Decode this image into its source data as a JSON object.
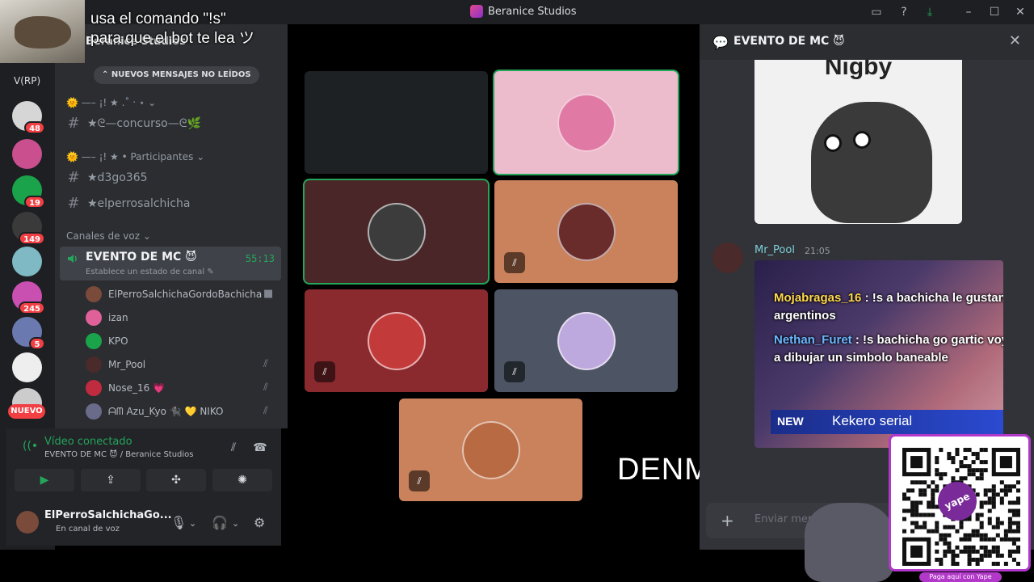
{
  "window": {
    "title": "Beranice Studios"
  },
  "overlay": {
    "command_line1": "usa el comando \"!s\"",
    "command_line2": "para que el bot te lea",
    "command_suffix": "ツ",
    "money_text": "DENME PLATA :,V",
    "qr_caption": "Paga aquí con Yape",
    "yape_label": "yape"
  },
  "rail": {
    "label": "V(RP)",
    "servers": [
      {
        "badge": "48",
        "color": "#d6d6d6"
      },
      {
        "badge": "",
        "color": "#c94f8f"
      },
      {
        "badge": "19",
        "color": "#1aa34a"
      },
      {
        "badge": "149",
        "color": "#3a3a3a"
      },
      {
        "badge": "",
        "color": "#7fb9c4"
      },
      {
        "badge": "245",
        "color": "#c94fb0"
      },
      {
        "badge": "5",
        "color": "#6a7ab0"
      },
      {
        "badge": "",
        "color": "#eeeeee"
      },
      {
        "badge": "",
        "color": "#cccccc"
      }
    ],
    "nuevo_label": "NUEVO"
  },
  "sidebar": {
    "server_name": "Beranice Studios",
    "new_messages_label": "NUEVOS MENSAJES NO LEÍDOS",
    "categories": [
      {
        "label": "—– ¡! ★ .˚ ‧ ⋆",
        "icon": "sun-emoji"
      },
      {
        "label": "—– ¡! ★ • Participantes",
        "icon": "sun-emoji"
      }
    ],
    "channels": [
      {
        "name": "★ᘓ—concurso—ᘓ🌿"
      },
      {
        "name": "★d3go365"
      },
      {
        "name": "★elperrosalchicha"
      }
    ],
    "voice_category": "Canales de voz",
    "voice_channel": {
      "name": "EVENTO DE MC 😈",
      "timer": "55:13",
      "status_placeholder": "Establece un estado de canal"
    },
    "members": [
      {
        "name": "ElPerroSalchichaGordoBachicha",
        "icon": "camera-icon",
        "color": "#7a4a3a"
      },
      {
        "name": "izan",
        "icon": "",
        "color": "#e0609a"
      },
      {
        "name": "KPO",
        "icon": "",
        "color": "#1aa34a"
      },
      {
        "name": "Mr_Pool",
        "icon": "muted-mic-icon",
        "color": "#4a2a2a"
      },
      {
        "name": "Nose_16 💗",
        "icon": "muted-mic-icon",
        "color": "#c02b3f"
      },
      {
        "name": "ᗩᗰ Azu_Kyo 🐈‍⬛ 💛 NIKO",
        "icon": "muted-mic-icon",
        "color": "#6a6a8a"
      }
    ]
  },
  "voice_panel": {
    "title": "Vídeo conectado",
    "subtitle": "EVENTO DE MC 😈 / Beranice Studios",
    "buttons": [
      "camera",
      "screen-share",
      "activities",
      "soundboard"
    ]
  },
  "user_panel": {
    "name": "ElPerroSalchichaGo...",
    "status": "En canal de voz"
  },
  "video_tiles": [
    {
      "bg": "#1e2124",
      "avatar": "",
      "speaking": false,
      "muted": false
    },
    {
      "bg": "#ecbccc",
      "avatar": "#e07aa4",
      "speaking": true,
      "muted": false
    },
    {
      "bg": "#4a2628",
      "avatar": "#3c3c3c",
      "speaking": true,
      "muted": false
    },
    {
      "bg": "#c9825b",
      "avatar": "#6a2b2b",
      "speaking": false,
      "muted": true
    },
    {
      "bg": "#8a2a2f",
      "avatar": "#c23a3a",
      "speaking": false,
      "muted": true
    },
    {
      "bg": "#4d5564",
      "avatar": "#bda9dd",
      "speaking": false,
      "muted": true
    },
    {
      "bg": "#c9825b",
      "avatar": "#b86a42",
      "speaking": false,
      "muted": true
    }
  ],
  "chat": {
    "title": "EVENTO DE MC 😈",
    "meme_text": "Nigby",
    "message": {
      "author": "Mr_Pool",
      "time": "21:05"
    },
    "screen_lines": [
      {
        "user": "Mojabragas_16",
        "text": ": !s a bachicha le gustan argentinos"
      },
      {
        "user": "Nethan_Furet",
        "text": ": !s bachicha go gartic voy a dibujar un simbolo baneable"
      }
    ],
    "news_tag": "NEW",
    "news_text": "Kekero serial",
    "input_placeholder": "Enviar mensaje..."
  }
}
